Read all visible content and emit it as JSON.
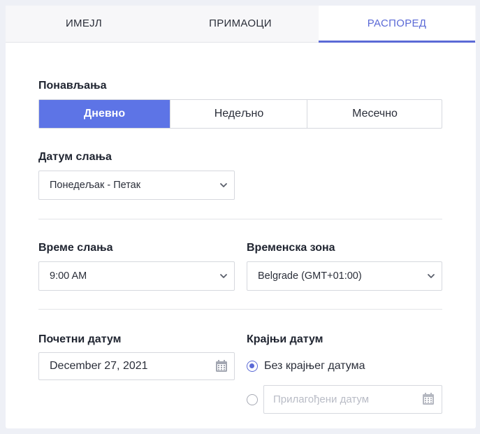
{
  "tabs": [
    {
      "label": "ИМЕЈЛ"
    },
    {
      "label": "ПРИМАОЦИ"
    },
    {
      "label": "РАСПОРЕД",
      "active": true
    }
  ],
  "repeat": {
    "label": "Понављања",
    "options": [
      "Дневно",
      "Недељно",
      "Месечно"
    ],
    "selected": "Дневно"
  },
  "send_date": {
    "label": "Датум слања",
    "value": "Понедељак - Петак"
  },
  "send_time": {
    "label": "Време слања",
    "value": "9:00 AM"
  },
  "timezone": {
    "label": "Временска зона",
    "value": "Belgrade (GMT+01:00)"
  },
  "start_date": {
    "label": "Почетни датум",
    "value": "December 27, 2021"
  },
  "end_date": {
    "label": "Крајњи датум",
    "no_end_label": "Без крајњег датума",
    "custom_placeholder": "Прилагођени датум",
    "selected": "no_end"
  },
  "colors": {
    "accent": "#5b6ad6",
    "selected_segment": "#5d74e6"
  },
  "icons": [
    "chevron-down-icon",
    "calendar-icon"
  ]
}
